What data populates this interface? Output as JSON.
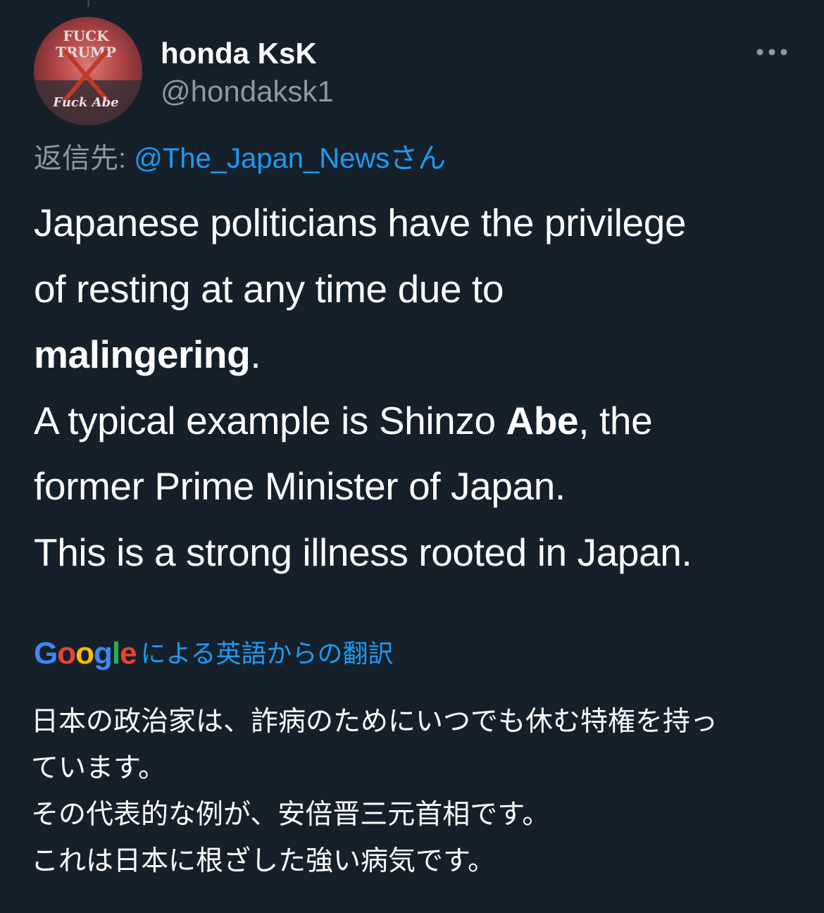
{
  "author": {
    "display_name": "honda KsK",
    "handle": "@hondaksk1",
    "avatar_text_top_1": "FUCK",
    "avatar_text_top_2": "TRUMP",
    "avatar_text_bottom": "Fuck Abe"
  },
  "reply": {
    "prefix": "返信先: ",
    "target": "@The_Japan_Newsさん"
  },
  "tweet": {
    "line1": "Japanese politicians have the privilege",
    "line2": "of resting at any time due to",
    "line3_bold": "malingering",
    "line3_end": ".",
    "line4_start": "A typical example is Shinzo ",
    "line4_bold": "Abe",
    "line4_end": ", the",
    "line5": "former Prime Minister of Japan.",
    "line6": "This is a strong illness rooted in Japan."
  },
  "translation": {
    "logo": [
      "G",
      "o",
      "o",
      "g",
      "l",
      "e"
    ],
    "label": "による英語からの翻訳",
    "line1": "日本の政治家は、詐病のためにいつでも休む特権を持っ",
    "line2": "ています。",
    "line3": "その代表的な例が、安倍晋三元首相です。",
    "line4": "これは日本に根ざした強い病気です。"
  },
  "icons": {
    "more": "more-horizontal-icon",
    "avatar": "avatar-image"
  },
  "colors": {
    "background": "#15202b",
    "text": "#ffffff",
    "secondary": "#8b98a5",
    "link": "#1d9bf0"
  }
}
